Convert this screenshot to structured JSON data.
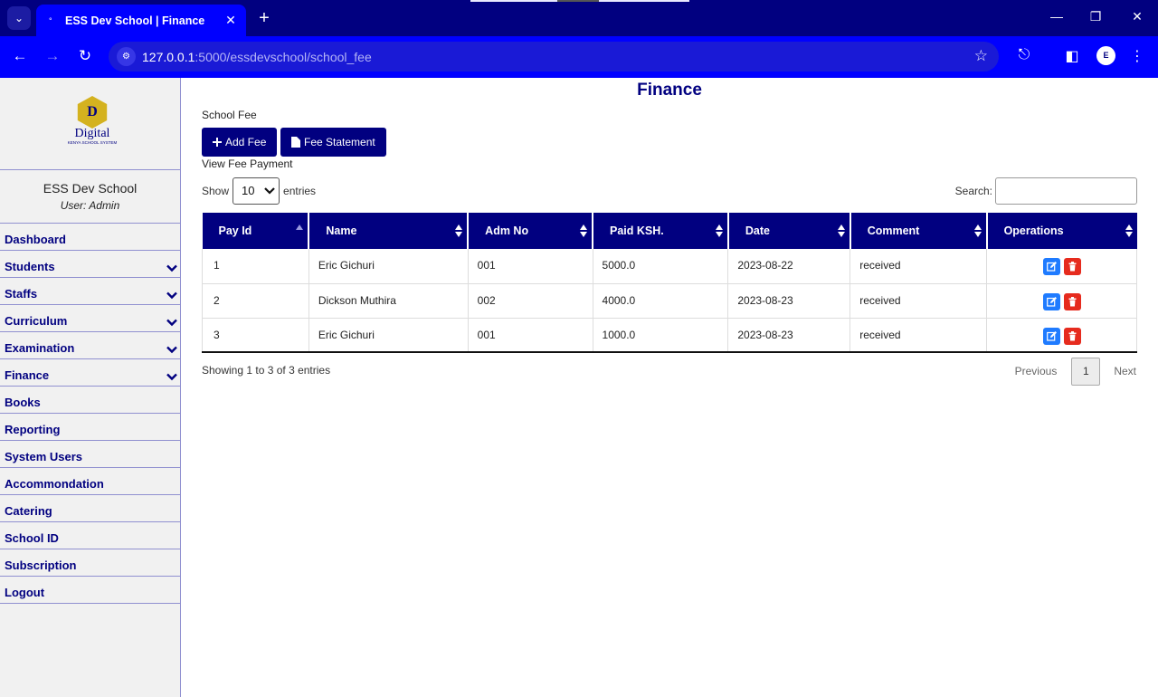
{
  "browser": {
    "tab_title": "ESS Dev School | Finance",
    "url_host": "127.0.0.1",
    "url_rest": ":5000/essdevschool/school_fee",
    "accent": "#0000ff",
    "frame": "#010080"
  },
  "sidebar": {
    "logo_word": "Digital",
    "logo_letter": "D",
    "logo_tagline": "KENYA SCHOOL SYSTEM",
    "school_name": "ESS Dev School",
    "user": "User: Admin",
    "items": [
      {
        "label": "Dashboard",
        "expandable": false
      },
      {
        "label": "Students",
        "expandable": true
      },
      {
        "label": "Staffs",
        "expandable": true
      },
      {
        "label": "Curriculum",
        "expandable": true
      },
      {
        "label": "Examination",
        "expandable": true
      },
      {
        "label": "Finance",
        "expandable": true
      },
      {
        "label": "Books",
        "expandable": false
      },
      {
        "label": "Reporting",
        "expandable": false
      },
      {
        "label": "System Users",
        "expandable": false
      },
      {
        "label": "Accommondation",
        "expandable": false
      },
      {
        "label": "Catering",
        "expandable": false
      },
      {
        "label": "School ID",
        "expandable": false
      },
      {
        "label": "Subscription",
        "expandable": false
      },
      {
        "label": "Logout",
        "expandable": false
      }
    ]
  },
  "main": {
    "title": "Finance",
    "section_label": "School Fee",
    "add_fee_label": "Add Fee",
    "fee_statement_label": "Fee Statement",
    "view_label": "View Fee Payment",
    "show_label": "Show",
    "entries_value": "10",
    "entries_label": "entries",
    "search_label": "Search:",
    "search_value": ""
  },
  "table": {
    "columns": [
      "Pay Id",
      "Name",
      "Adm No",
      "Paid KSH.",
      "Date",
      "Comment",
      "Operations"
    ],
    "rows": [
      [
        "1",
        "Eric Gichuri",
        "001",
        "5000.0",
        "2023-08-22",
        "received"
      ],
      [
        "2",
        "Dickson Muthira",
        "002",
        "4000.0",
        "2023-08-23",
        "received"
      ],
      [
        "3",
        "Eric Gichuri",
        "001",
        "1000.0",
        "2023-08-23",
        "received"
      ]
    ]
  },
  "footer": {
    "info": "Showing 1 to 3 of 3 entries",
    "previous": "Previous",
    "page": "1",
    "next": "Next"
  }
}
